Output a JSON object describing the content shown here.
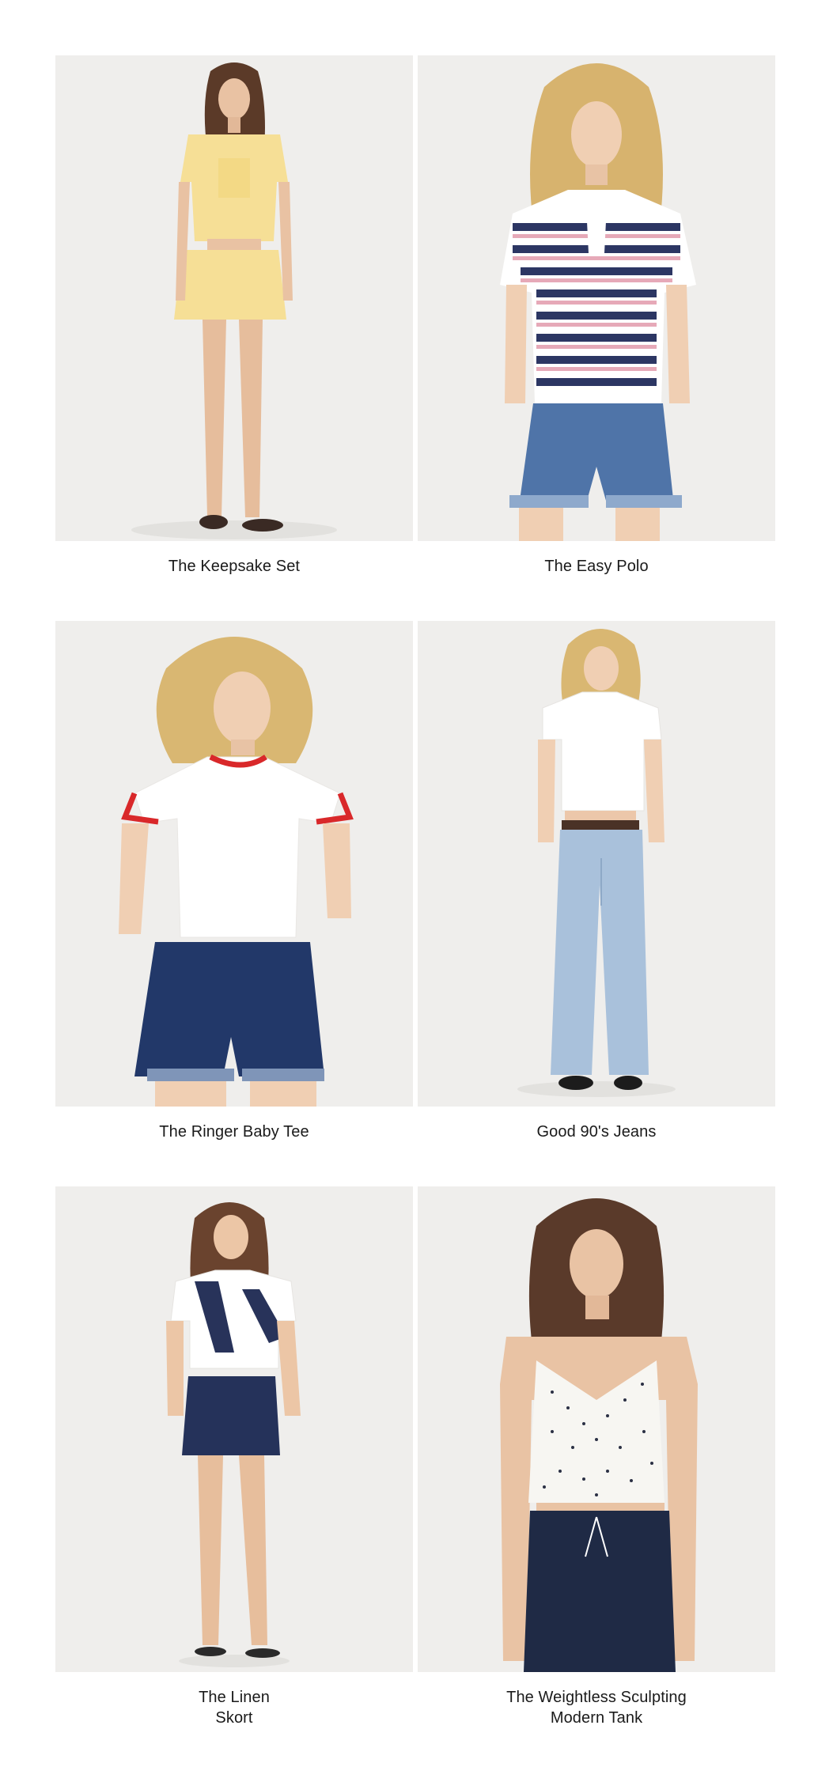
{
  "products": [
    {
      "name": "The Keepsake Set",
      "image": "woman in yellow knit cardigan, crop top and mini skirt with brown flats"
    },
    {
      "name": "The Easy Polo",
      "image": "woman in navy, white and pink striped polo with cuffed denim shorts"
    },
    {
      "name": "The Ringer Baby Tee",
      "image": "woman in white ringer tee with red trim and dark denim shorts"
    },
    {
      "name": "Good 90's Jeans",
      "image": "woman in white baby tee and light wash wide-leg jeans"
    },
    {
      "name": "The Linen\nSkort",
      "image": "woman in white tee with navy linen skort and sandals"
    },
    {
      "name": "The Weightless Sculpting\nModern Tank",
      "image": "woman in white polka dot cami tank and navy pants"
    }
  ],
  "colors": {
    "photo_bg": "#efeeec",
    "text": "#1a1a1a",
    "page_bg": "#ffffff"
  }
}
